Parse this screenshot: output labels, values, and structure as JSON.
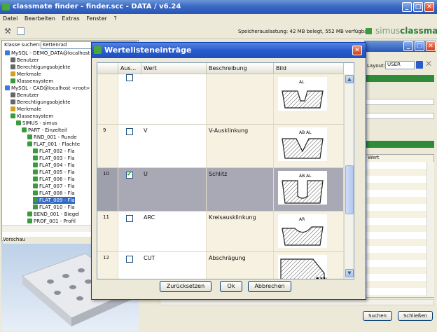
{
  "app": {
    "title": "classmate finder - finder.scc - DATA / v6.24",
    "status": "Speicherauslastung: 42 MB belegt, 552 MB verfügbar",
    "logo_prefix": "simus",
    "logo_suffix": "classmate",
    "menu": [
      "Datei",
      "Bearbeiten",
      "Extras",
      "Fenster",
      "?"
    ]
  },
  "left": {
    "search_label": "Klasse suchen:",
    "search_value": "Kettenrad",
    "preview_label": "Vorschau",
    "tree": [
      "MySQL - DEMO_DATA@localhost <",
      "Benutzer",
      "Berechtigungsobjekte",
      "Merkmale",
      "Klassensystem",
      "MySQL - CAD@localhost <root>",
      "Benutzer",
      "Berechtigungsobjekte",
      "Merkmale",
      "Klassensystem",
      "SIMUS - simus",
      "PART - Einzelteil",
      "RND_001 - Runde",
      "FLAT_001 - Flachte",
      "FLAT_002 - Fla",
      "FLAT_003 - Fla",
      "FLAT_004 - Fla",
      "FLAT_005 - Fla",
      "FLAT_006 - Fla",
      "FLAT_007 - Fla",
      "FLAT_008 - Fla",
      "FLAT_009 - Fla",
      "FLAT_010 - Fla",
      "BEND_001 - Biegel",
      "PROF_001 - Profil"
    ]
  },
  "right": {
    "layout_label": "Layout:",
    "layout_value": "USER",
    "col_wert": "Wert",
    "suchen": "Suchen",
    "schliessen": "Schließen"
  },
  "dialog": {
    "title": "Wertelisteneinträge",
    "headers": [
      "Aus...",
      "Wert",
      "Beschreibung",
      "Bild"
    ],
    "rows": [
      {
        "num": "",
        "checked": false,
        "wert": "",
        "desc": "",
        "img_label": "AL"
      },
      {
        "num": "9",
        "checked": false,
        "wert": "V",
        "desc": "V-Ausklinkung",
        "img_label": "AB AL"
      },
      {
        "num": "10",
        "checked": true,
        "wert": "U",
        "desc": "Schlitz",
        "img_label": "AB AL"
      },
      {
        "num": "11",
        "checked": false,
        "wert": "ARC",
        "desc": "Kreisausklinkung",
        "img_label": "AR"
      },
      {
        "num": "12",
        "checked": false,
        "wert": "CUT",
        "desc": "Abschrägung",
        "img_label": "AW"
      }
    ],
    "btn_reset": "Zurücksetzen",
    "btn_ok": "Ok",
    "btn_cancel": "Abbrechen"
  }
}
